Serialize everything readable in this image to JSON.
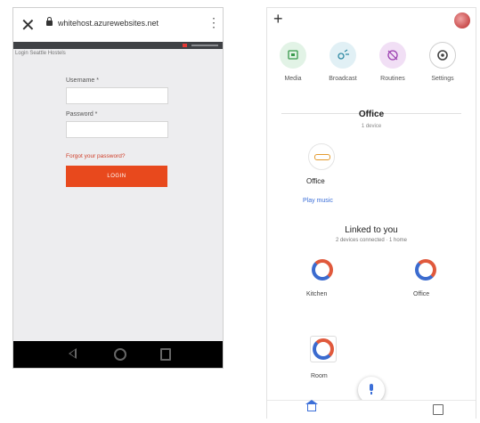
{
  "colors": {
    "login_accent": "#e8491d",
    "link_red": "#d0402b",
    "google_blue": "#3c6fd8",
    "media_green": "#e2f3e6",
    "broadcast_teal": "#e1f0f5",
    "routines_purple": "#f1dff5"
  },
  "left": {
    "close_icon": "close-icon",
    "url": "whitehost.azurewebsites.net",
    "crumb": "Login Seattle Hostels",
    "username_label": "Username *",
    "password_label": "Password *",
    "forgot_link": "Forgot your password?",
    "login_button": "LOGIN",
    "nav_icons": [
      "back-icon",
      "home-icon",
      "recent-apps-icon"
    ]
  },
  "right": {
    "quick_actions": [
      {
        "label": "Media",
        "icon": "media-icon"
      },
      {
        "label": "Broadcast",
        "icon": "broadcast-icon"
      },
      {
        "label": "Routines",
        "icon": "routines-icon"
      },
      {
        "label": "Settings",
        "icon": "settings-icon"
      }
    ],
    "home_title": "Office",
    "home_sub": "1 device",
    "device_name": "Office",
    "play_music": "Play music",
    "linked_title": "Linked to you",
    "linked_sub": "2 devices connected · 1 home",
    "linked_devices": [
      {
        "name": "Kitchen",
        "icon": "thermostat-icon"
      },
      {
        "name": "Office",
        "icon": "thermostat-icon"
      }
    ],
    "room_device": {
      "name": "Room",
      "icon": "thermostat-icon"
    },
    "bottom_nav": [
      "home-icon",
      "feed-icon"
    ]
  }
}
